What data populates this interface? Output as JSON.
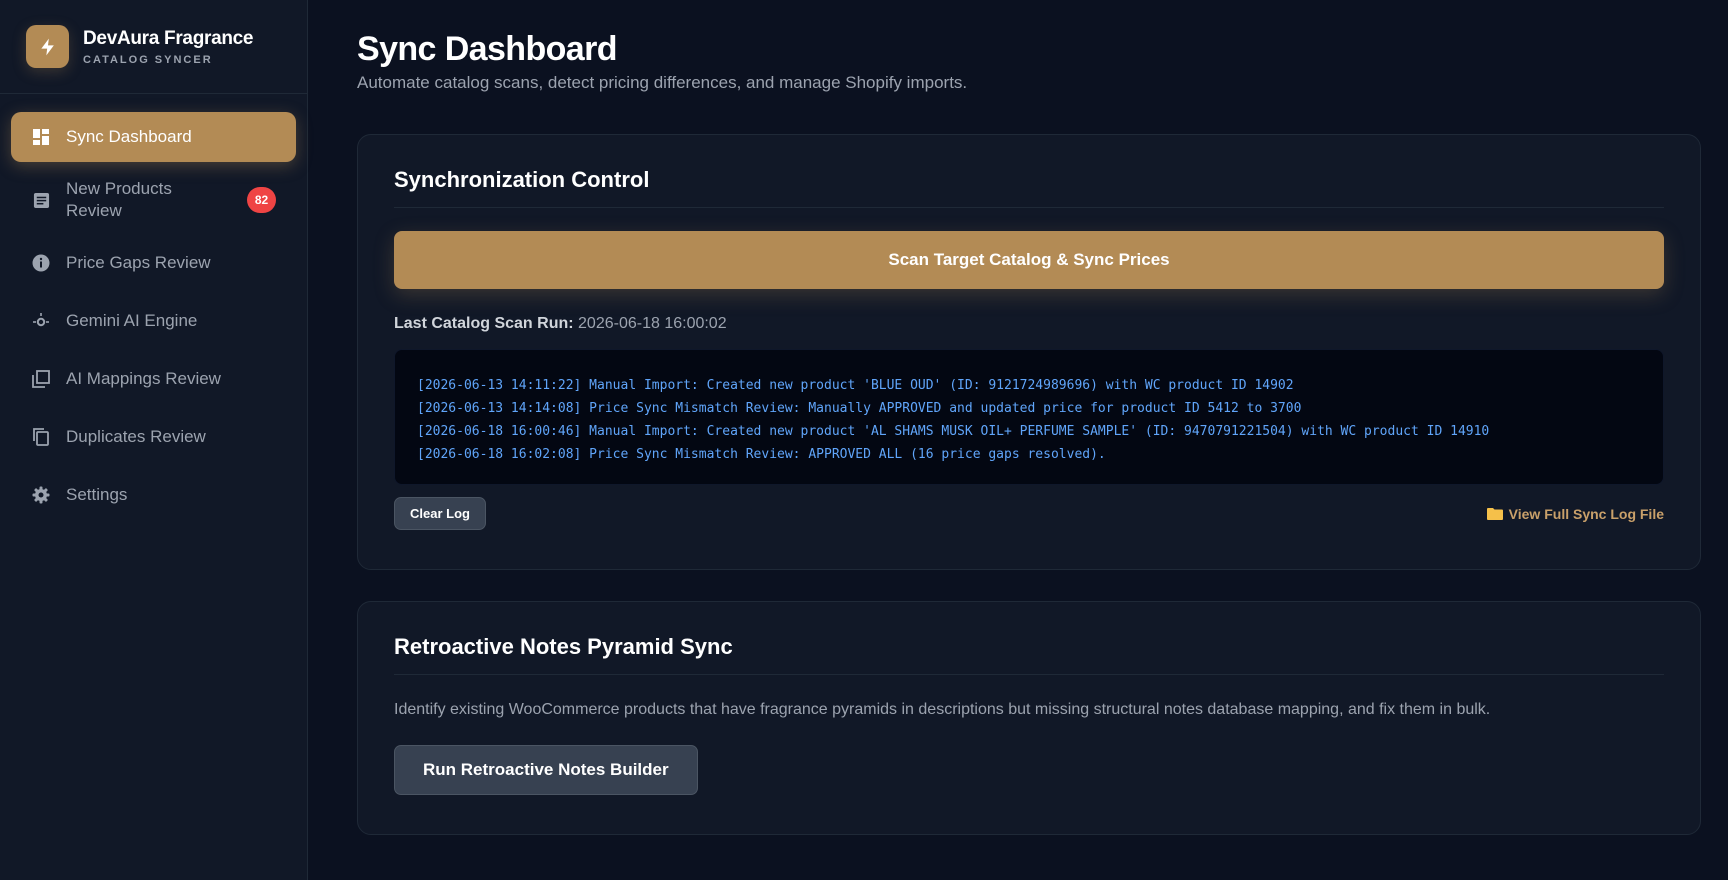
{
  "brand": {
    "name": "DevAura Fragrance",
    "subtitle": "CATALOG SYNCER",
    "logo_icon": "bolt-icon",
    "accent_color": "#b38b55"
  },
  "sidebar": {
    "items": [
      {
        "label": "Sync Dashboard",
        "icon": "dashboard-icon",
        "active": true
      },
      {
        "label": "New Products Review",
        "icon": "list-icon",
        "badge": "82"
      },
      {
        "label": "Price Gaps Review",
        "icon": "info-icon"
      },
      {
        "label": "Gemini AI Engine",
        "icon": "sparkle-icon"
      },
      {
        "label": "AI Mappings Review",
        "icon": "layers-icon"
      },
      {
        "label": "Duplicates Review",
        "icon": "copy-icon"
      },
      {
        "label": "Settings",
        "icon": "gear-icon"
      }
    ]
  },
  "header": {
    "title": "Sync Dashboard",
    "subtitle": "Automate catalog scans, detect pricing differences, and manage Shopify imports."
  },
  "sync_card": {
    "title": "Synchronization Control",
    "scan_button": "Scan Target Catalog & Sync Prices",
    "last_run_label": "Last Catalog Scan Run:",
    "last_run_value": "2026-06-18 16:00:02",
    "log_lines": [
      "[2026-06-13 14:11:22] Manual Import: Created new product 'BLUE OUD' (ID: 9121724989696) with WC product ID 14902",
      "[2026-06-13 14:14:08] Price Sync Mismatch Review: Manually APPROVED and updated price for product ID 5412 to 3700",
      "[2026-06-18 16:00:46] Manual Import: Created new product 'AL SHAMS MUSK OIL+ PERFUME SAMPLE' (ID: 9470791221504) with WC product ID 14910",
      "[2026-06-18 16:02:08] Price Sync Mismatch Review: APPROVED ALL (16 price gaps resolved)."
    ],
    "clear_button": "Clear Log",
    "view_log_link": "View Full Sync Log File"
  },
  "retro_card": {
    "title": "Retroactive Notes Pyramid Sync",
    "description": "Identify existing WooCommerce products that have fragrance pyramids in descriptions but missing structural notes database mapping, and fix them in bulk.",
    "button": "Run Retroactive Notes Builder"
  }
}
